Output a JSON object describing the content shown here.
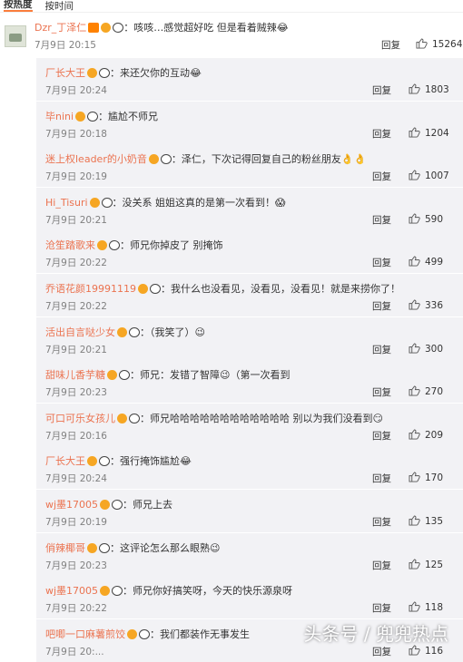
{
  "tabs": [
    "按热度",
    "按时间"
  ],
  "main_comment": {
    "user": "Dzr_丁泽仁",
    "text": "：咳咳…感觉超好吃 但是看着贼辣😂",
    "time": "7月9日 20:15",
    "reply": "回复",
    "likes": "15264"
  },
  "replies": [
    {
      "user": "厂长大王",
      "text": "：来还欠你的互动😂",
      "time": "7月9日 20:24",
      "reply": "回复",
      "likes": "1803"
    },
    {
      "user": "毕nini",
      "text": "：尴尬不师兄",
      "time": "7月9日 20:18",
      "reply": "回复",
      "likes": "1204"
    },
    {
      "user": "迷上权leader的小奶音",
      "text": "：泽仁，下次记得回复自己的粉丝朋友👌👌",
      "time": "7月9日 20:19",
      "reply": "回复",
      "likes": "1007"
    },
    {
      "user": "Hi_Tisuri",
      "text": "：没关系 姐姐这真的是第一次看到！😱",
      "time": "7月9日 20:21",
      "reply": "回复",
      "likes": "590"
    },
    {
      "user": "沧笙踏歌来",
      "text": "：师兄你掉皮了 别掩饰",
      "time": "7月9日 20:22",
      "reply": "回复",
      "likes": "499"
    },
    {
      "user": "乔语花颜19991119",
      "text": "：我什么也没看见，没看见，没看见！就是来捞你了！",
      "time": "7月9日 20:22",
      "reply": "回复",
      "likes": "336"
    },
    {
      "user": "活出自言哒少女",
      "text": "：（我笑了）😉",
      "time": "7月9日 20:21",
      "reply": "回复",
      "likes": "300"
    },
    {
      "user": "甜味儿香芋糖",
      "text": "：师兄：发错了智障😉（第一次看到",
      "time": "7月9日 20:23",
      "reply": "回复",
      "likes": "270"
    },
    {
      "user": "可口可乐女孩儿",
      "text": "：师兄哈哈哈哈哈哈哈哈哈哈哈哈 别以为我们没看到😏",
      "time": "7月9日 20:16",
      "reply": "回复",
      "likes": "209"
    },
    {
      "user": "厂长大王",
      "text": "：强行掩饰尴尬😂",
      "time": "7月9日 20:24",
      "reply": "回复",
      "likes": "170"
    },
    {
      "user": "wj墨17005",
      "text": "：师兄上去",
      "time": "7月9日 20:19",
      "reply": "回复",
      "likes": "135"
    },
    {
      "user": "俏辣椰哥",
      "text": "：这评论怎么那么眼熟😉",
      "time": "7月9日 20:23",
      "reply": "回复",
      "likes": "125"
    },
    {
      "user": "wj墨17005",
      "text": "：师兄你好搞笑呀，今天的快乐源泉呀",
      "time": "7月9日 20:22",
      "reply": "回复",
      "likes": "118"
    },
    {
      "user": "吧唧一口麻薯煎饺",
      "text": "：我们都装作无事发生",
      "time": "7月9日 20:...",
      "reply": "回复",
      "likes": "116"
    }
  ],
  "watermark": "头条号 / 兜兜热点",
  "colors": {
    "username": "#eb7350",
    "reply_bg": "#f2f2f5",
    "accent": "#fa7d3c"
  }
}
